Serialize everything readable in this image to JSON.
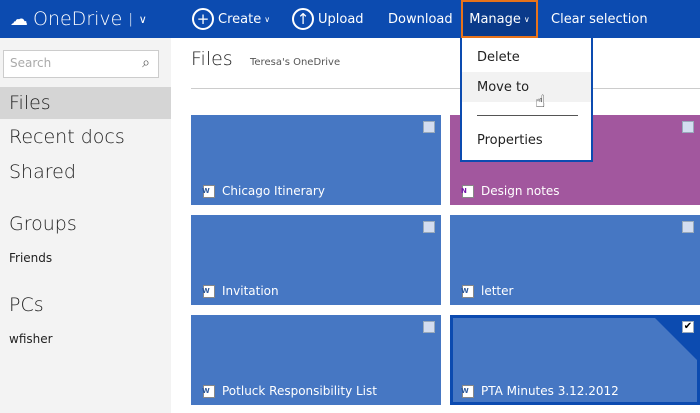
{
  "topbar": {
    "app_name": "OneDrive",
    "create": "Create",
    "upload": "Upload",
    "download": "Download",
    "manage": "Manage",
    "clear_selection": "Clear selection"
  },
  "sidebar": {
    "search_placeholder": "Search",
    "items": [
      {
        "label": "Files"
      },
      {
        "label": "Recent docs"
      },
      {
        "label": "Shared"
      }
    ],
    "groups_heading": "Groups",
    "groups": [
      "Friends"
    ],
    "pcs_heading": "PCs",
    "pcs": [
      "wfisher"
    ]
  },
  "main": {
    "title": "Files",
    "subtitle": "Teresa's OneDrive",
    "files": [
      {
        "name": "Chicago Itinerary",
        "type": "word",
        "checked": false
      },
      {
        "name": "Design notes",
        "type": "onenote",
        "checked": false
      },
      {
        "name": "Invitation",
        "type": "word",
        "checked": false
      },
      {
        "name": "letter",
        "type": "word",
        "checked": false
      },
      {
        "name": "Potluck Responsibility List",
        "type": "word",
        "checked": false
      },
      {
        "name": "PTA Minutes 3.12.2012",
        "type": "word",
        "checked": true
      }
    ]
  },
  "manage_menu": {
    "items": [
      "Delete",
      "Move to",
      "Properties"
    ]
  },
  "colors": {
    "topbar": "#0c4bb0",
    "tile_blue": "#4677c3",
    "tile_purple": "#a2579e",
    "highlight": "#e8731a"
  }
}
